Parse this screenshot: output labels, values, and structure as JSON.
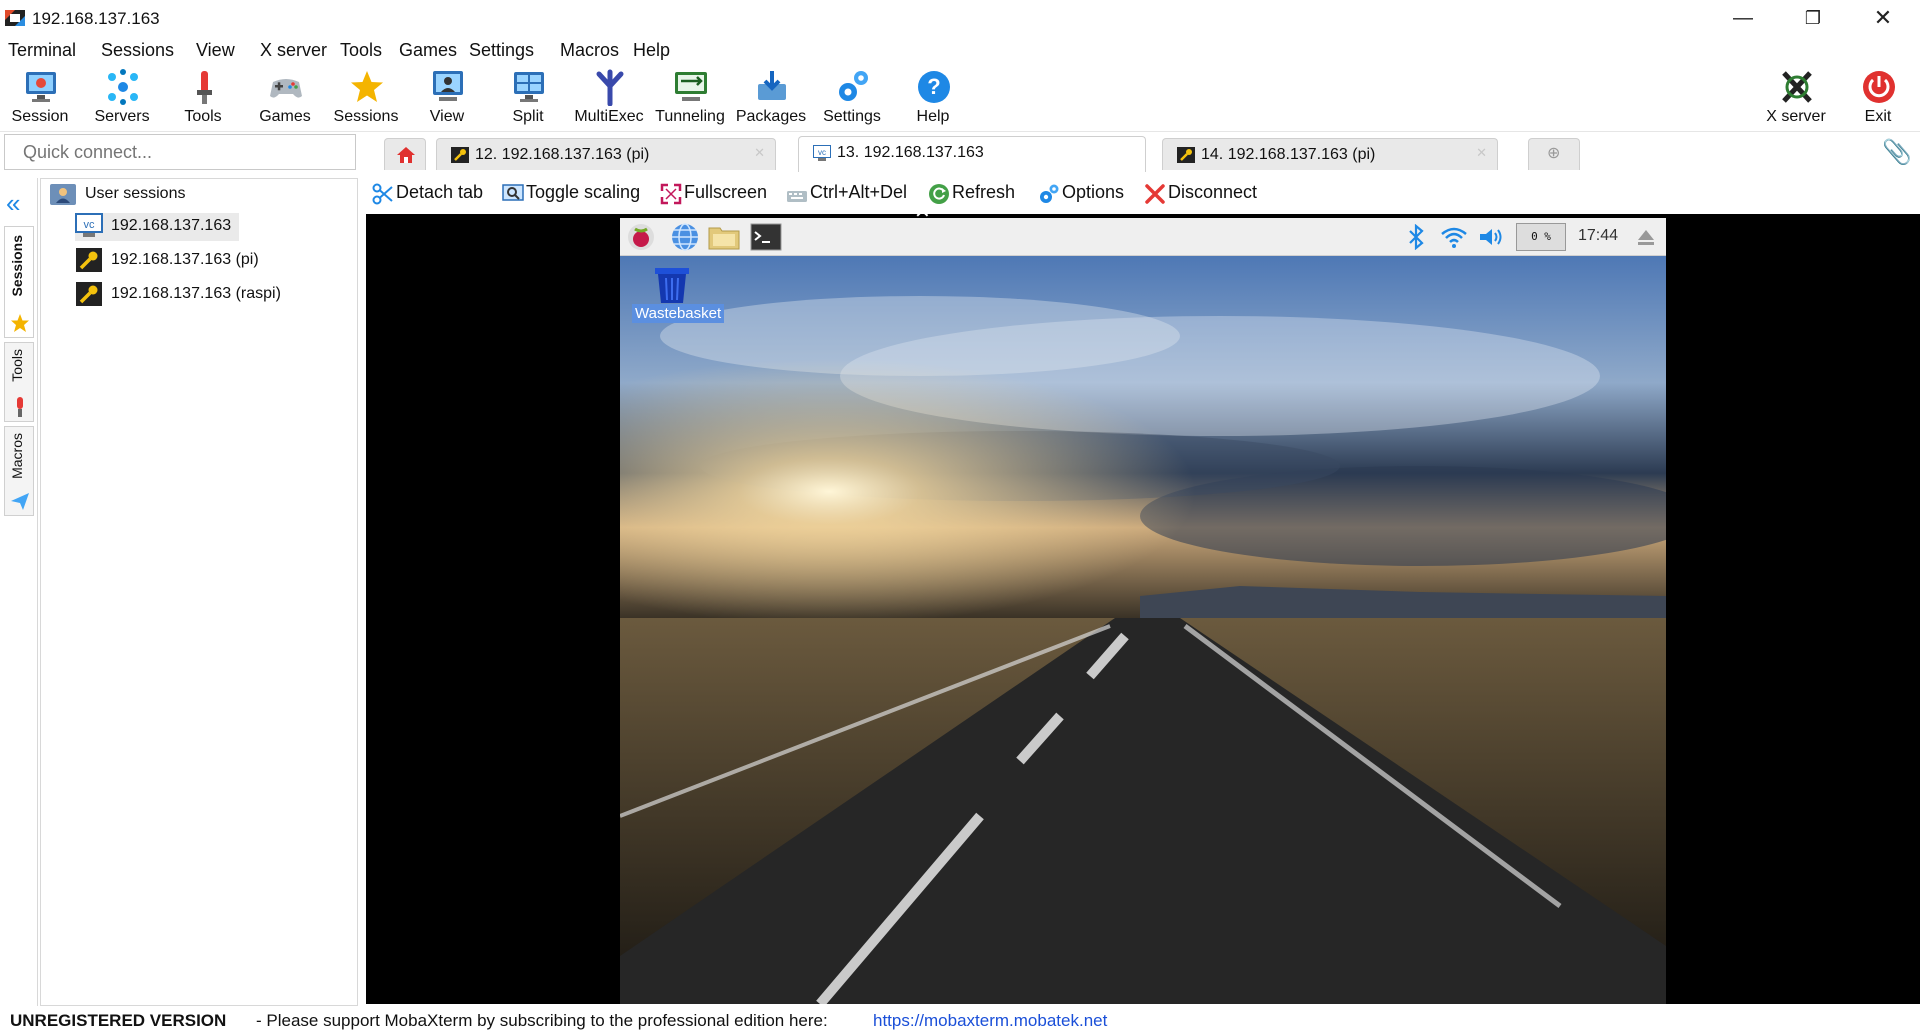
{
  "window": {
    "title": "192.168.137.163"
  },
  "menu": [
    "Terminal",
    "Sessions",
    "View",
    "X server",
    "Tools",
    "Games",
    "Settings",
    "Macros",
    "Help"
  ],
  "toolbar": {
    "session": "Session",
    "servers": "Servers",
    "tools": "Tools",
    "games": "Games",
    "sessions": "Sessions",
    "view": "View",
    "split": "Split",
    "multiexec": "MultiExec",
    "tunneling": "Tunneling",
    "packages": "Packages",
    "settings": "Settings",
    "help": "Help",
    "xserver": "X server",
    "exit": "Exit"
  },
  "quick_connect": {
    "placeholder": "Quick connect..."
  },
  "tabs": [
    {
      "label": "12. 192.168.137.163 (pi)",
      "icon": "ssh-key-icon"
    },
    {
      "label": "13. 192.168.137.163",
      "icon": "vnc-icon",
      "active": true
    },
    {
      "label": "14. 192.168.137.163 (pi)",
      "icon": "ssh-key-icon"
    }
  ],
  "side_tabs": {
    "sessions": "Sessions",
    "tools": "Tools",
    "macros": "Macros"
  },
  "tree": {
    "root": "User sessions",
    "items": [
      "192.168.137.163",
      "192.168.137.163 (pi)",
      "192.168.137.163 (raspi)"
    ]
  },
  "session_toolbar": {
    "detach": "Detach tab",
    "toggle_scaling": "Toggle scaling",
    "fullscreen": "Fullscreen",
    "ctrl_alt_del": "Ctrl+Alt+Del",
    "refresh": "Refresh",
    "options": "Options",
    "disconnect": "Disconnect"
  },
  "remote": {
    "desktop_icon": "Wastebasket",
    "cpu": "0 %",
    "clock": "17:44"
  },
  "status": {
    "unregistered": "UNREGISTERED VERSION",
    "support": "-  Please support MobaXterm by subscribing to the professional edition here:",
    "link": "https://mobaxterm.mobatek.net"
  },
  "colors": {
    "accent": "#1a6fd8",
    "link": "#1a4fd8",
    "exit_red": "#e0312f"
  }
}
